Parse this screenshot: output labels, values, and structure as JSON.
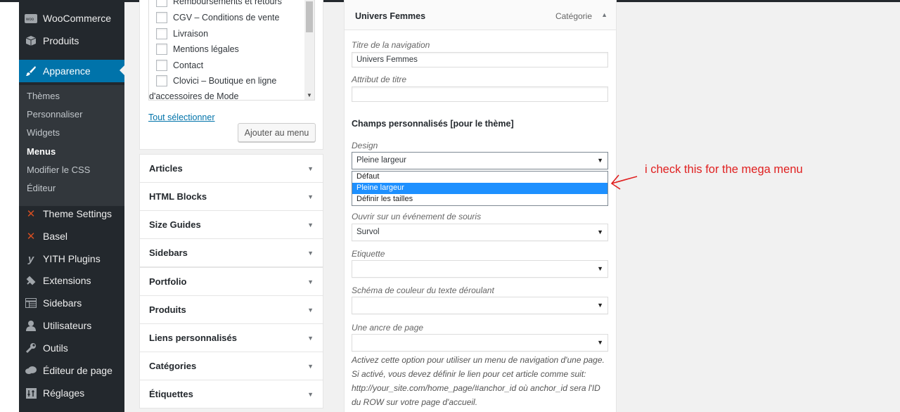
{
  "admin_menu": {
    "items": [
      {
        "label": "WooCommerce",
        "icon": "woocommerce-icon"
      },
      {
        "label": "Produits",
        "icon": "box-icon"
      },
      {
        "label": "Apparence",
        "icon": "paintbrush-icon"
      },
      {
        "label": "Theme Settings",
        "icon": "theme-settings-icon"
      },
      {
        "label": "Basel",
        "icon": "basel-icon"
      },
      {
        "label": "YITH Plugins",
        "icon": "yith-icon"
      },
      {
        "label": "Extensions",
        "icon": "plugin-icon"
      },
      {
        "label": "Sidebars",
        "icon": "table-icon"
      },
      {
        "label": "Utilisateurs",
        "icon": "user-icon"
      },
      {
        "label": "Outils",
        "icon": "wrench-icon"
      },
      {
        "label": "Éditeur de page",
        "icon": "cloud-icon"
      },
      {
        "label": "Réglages",
        "icon": "settings-icon"
      }
    ],
    "submenu": [
      "Thèmes",
      "Personnaliser",
      "Widgets",
      "Menus",
      "Modifier le CSS",
      "Éditeur"
    ]
  },
  "checklist": {
    "items": [
      "Remboursements et retours",
      "CGV – Conditions de vente",
      "Livraison",
      "Mentions légales",
      "Contact",
      "Clovici – Boutique en ligne",
      "d'accessoires de Mode"
    ],
    "select_all": "Tout sélectionner",
    "add_button": "Ajouter au menu"
  },
  "accordion": [
    "Articles",
    "HTML Blocks",
    "Size Guides",
    "Sidebars",
    "Portfolio",
    "Produits",
    "Liens personnalisés",
    "Catégories",
    "Étiquettes"
  ],
  "panel": {
    "title": "Univers Femmes",
    "type": "Catégorie",
    "nav_label": "Titre de la navigation",
    "nav_value": "Univers Femmes",
    "attr_label": "Attribut de titre",
    "attr_value": "",
    "custom_fields": "Champs personnalisés [pour le thème]",
    "design_label": "Design",
    "design_value": "Pleine largeur",
    "design_options": [
      "Défaut",
      "Pleine largeur",
      "Définir les tailles"
    ],
    "mouse_label": "Ouvrir sur un événement de souris",
    "mouse_value": "Survol",
    "etiquette_label": "Etiquette",
    "etiquette_value": "",
    "scheme_label": "Schéma de couleur du texte déroulant",
    "scheme_value": "",
    "anchor_label": "Une ancre de page",
    "anchor_value": "",
    "description_lines": [
      "Activez cette option pour utiliser un menu de navigation d'une page.",
      "Si activé, vous devez définir le lien pour cet article comme suit:",
      "http://your_site.com/home_page/#anchor_id où anchor_id sera l'ID",
      "du ROW sur votre page d'accueil."
    ]
  },
  "annotation": "i check this for the mega menu",
  "colors": {
    "admin_bg": "#23282d",
    "active": "#0073aa",
    "highlight": "#1e90ff",
    "annotation": "#e02020"
  }
}
